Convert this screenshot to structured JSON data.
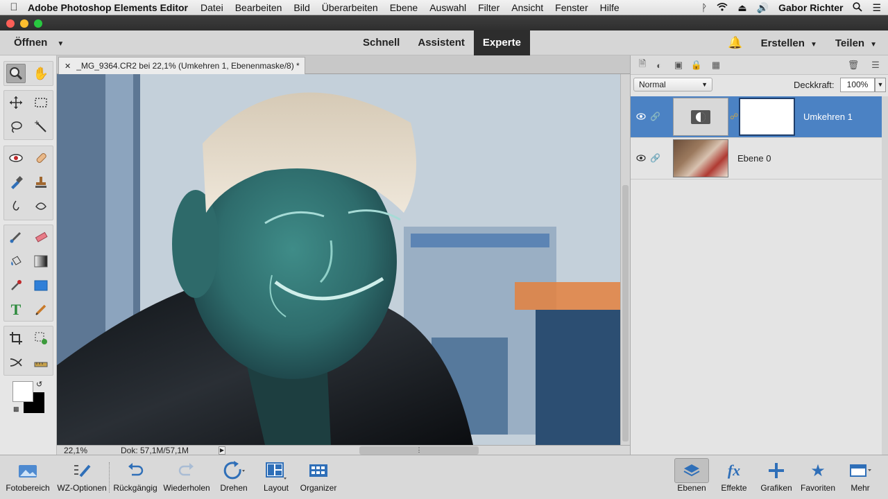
{
  "menubar": {
    "app_name": "Adobe Photoshop Elements Editor",
    "menus": [
      "Datei",
      "Bearbeiten",
      "Bild",
      "Überarbeiten",
      "Ebene",
      "Auswahl",
      "Filter",
      "Ansicht",
      "Fenster",
      "Hilfe"
    ],
    "user": "Gabor Richter"
  },
  "modebar": {
    "open_label": "Öffnen",
    "modes": [
      "Schnell",
      "Assistent",
      "Experte"
    ],
    "active_mode": "Experte",
    "create_label": "Erstellen",
    "share_label": "Teilen"
  },
  "document": {
    "tab_title": "_MG_9364.CR2 bei 22,1% (Umkehren 1, Ebenenmaske/8) *",
    "zoom": "22,1%",
    "doc_size": "Dok: 57,1M/57,1M"
  },
  "layers_panel": {
    "blend_mode": "Normal",
    "opacity_label": "Deckkraft:",
    "opacity_value": "100%",
    "layers": [
      {
        "name": "Umkehren 1",
        "active": true
      },
      {
        "name": "Ebene 0",
        "active": false
      }
    ]
  },
  "taskbar": {
    "items": [
      {
        "label": "Fotobereich",
        "icon": "photo-bin-icon"
      },
      {
        "label": "WZ-Optionen",
        "icon": "tool-options-icon"
      },
      {
        "label": "Rückgängig",
        "icon": "undo-icon"
      },
      {
        "label": "Wiederholen",
        "icon": "redo-icon"
      },
      {
        "label": "Drehen",
        "icon": "rotate-icon"
      },
      {
        "label": "Layout",
        "icon": "layout-icon"
      },
      {
        "label": "Organizer",
        "icon": "organizer-icon"
      }
    ],
    "panel_items": [
      {
        "label": "Ebenen",
        "icon": "layers-icon"
      },
      {
        "label": "Effekte",
        "icon": "fx-icon"
      },
      {
        "label": "Grafiken",
        "icon": "plus-icon"
      },
      {
        "label": "Favoriten",
        "icon": "star-icon"
      },
      {
        "label": "Mehr",
        "icon": "more-icon"
      }
    ]
  },
  "colors": {
    "accent_blue": "#4b82c4",
    "mode_active_bg": "#2d2d2d",
    "icon_blue": "#2f6fb8"
  }
}
